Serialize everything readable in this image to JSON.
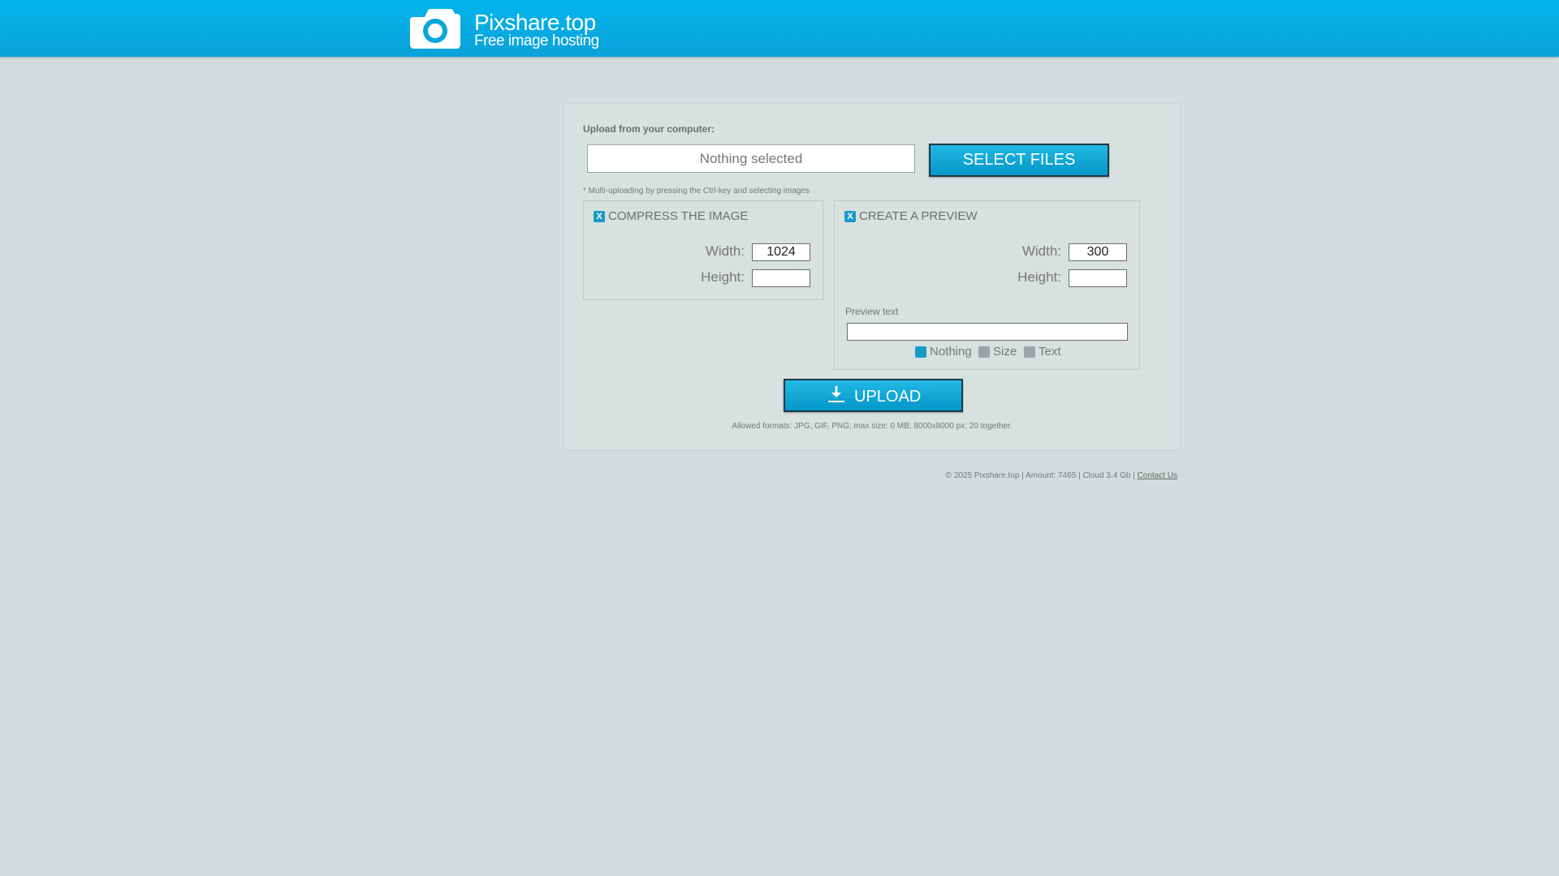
{
  "header": {
    "title": "Pixshare.top",
    "subtitle": "Free image hosting",
    "logo_icon": "camera-icon",
    "background": "#05b4ec"
  },
  "upload": {
    "label": "Upload from your computer:",
    "file_field_text": "Nothing selected",
    "select_button": "SELECT FILES",
    "hint": "* Multi-uploading by pressing the Ctrl-key and selecting images"
  },
  "compress": {
    "checked_mark": "X",
    "title": "COMPRESS THE IMAGE",
    "width_label": "Width:",
    "width_value": "1024",
    "height_label": "Height:",
    "height_value": ""
  },
  "preview": {
    "checked_mark": "X",
    "title": "CREATE A PREVIEW",
    "width_label": "Width:",
    "width_value": "300",
    "height_label": "Height:",
    "height_value": "",
    "text_label": "Preview text",
    "text_value": "",
    "options": [
      {
        "label": "Nothing",
        "selected": true
      },
      {
        "label": "Size",
        "selected": false
      },
      {
        "label": "Text",
        "selected": false
      }
    ]
  },
  "submit": {
    "label": "UPLOAD",
    "icon": "download-arrow-icon",
    "formats": "Allowed formats: JPG, GIF, PNG; max size: 0 MB; 8000x8000 px; 20 together."
  },
  "footer": {
    "text": "© 2025 Pixshare.top | Amount: 7465 | Cloud 3.4 Gb | ",
    "contact_link": "Contact Us"
  },
  "colors": {
    "accent": "#1a9ac8",
    "page_background": "#d2dedd"
  }
}
